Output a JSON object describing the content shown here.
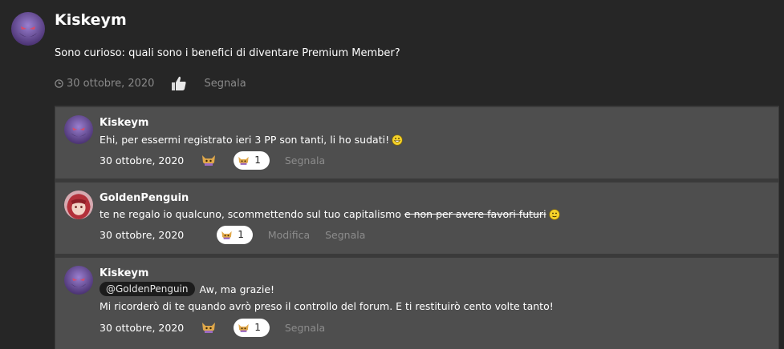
{
  "post": {
    "author": "Kiskeym",
    "text": "Sono curioso: quali sono i benefici di diventare Premium Member?",
    "date": "30 ottobre, 2020",
    "report": "Segnala"
  },
  "replies": [
    {
      "author": "Kiskeym",
      "text": "Ehi, per essermi registrato ieri 3 PP son tanti, li ho sudati!",
      "emoji": "grinning-sweat-emoji",
      "date": "30 ottobre, 2020",
      "reaction_count": "1",
      "report": "Segnala"
    },
    {
      "author": "GoldenPenguin",
      "text": "te ne regalo io qualcuno, scommettendo sul tuo capitalismo",
      "strikethrough": "e non per avere favori futuri",
      "emoji": "neutral-smile-emoji",
      "date": "30 ottobre, 2020",
      "reaction_count": "1",
      "edit": "Modifica",
      "report": "Segnala"
    },
    {
      "author": "Kiskeym",
      "mention": "@GoldenPenguin",
      "text_line1": "Aw, ma grazie!",
      "text_line2": "Mi ricorderò di te quando avrò preso il controllo del forum. E ti restituirò cento volte tanto!",
      "date": "30 ottobre, 2020",
      "reaction_count": "1",
      "report": "Segnala"
    }
  ],
  "colors": {
    "page_bg": "#262626",
    "replies_bg": "#3a3a3a",
    "reply_card": "#4e4e4e",
    "muted_link": "#8c8c8c",
    "avatar_purple": "#6a4e9e"
  }
}
